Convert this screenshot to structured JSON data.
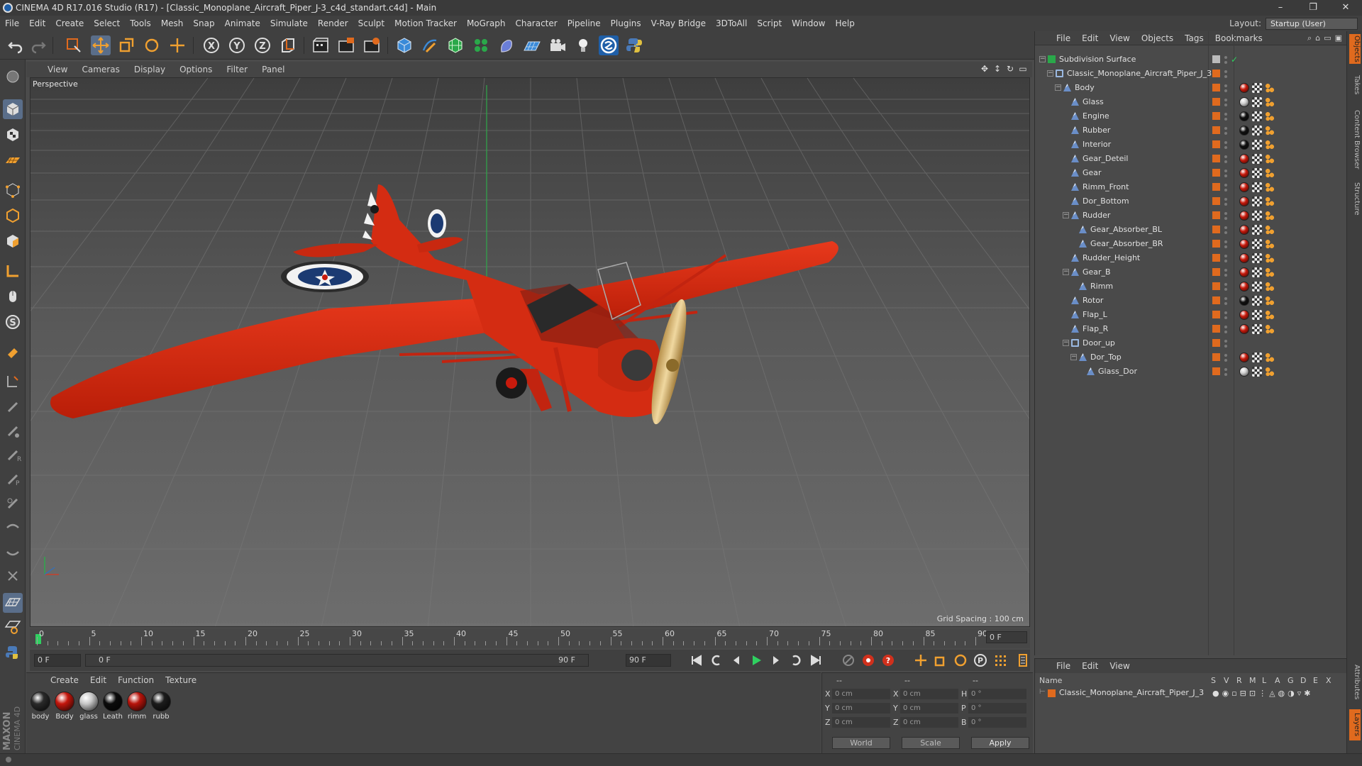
{
  "window": {
    "title": "CINEMA 4D R17.016 Studio (R17) - [Classic_Monoplane_Aircraft_Piper_J-3_c4d_standart.c4d] - Main",
    "controls": [
      "–",
      "❐",
      "✕"
    ]
  },
  "menubar": {
    "items": [
      "File",
      "Edit",
      "Create",
      "Select",
      "Tools",
      "Mesh",
      "Snap",
      "Animate",
      "Simulate",
      "Render",
      "Sculpt",
      "Motion Tracker",
      "MoGraph",
      "Character",
      "Pipeline",
      "Plugins",
      "V-Ray Bridge",
      "3DToAll",
      "Script",
      "Window",
      "Help"
    ],
    "layout_label": "Layout:",
    "layout_value": "Startup (User)"
  },
  "toolbar": {
    "icons": [
      "undo-icon",
      "redo-icon",
      "select-icon",
      "move-icon",
      "scale-icon",
      "rotate-icon",
      "move-plus-icon",
      "x-axis-icon",
      "y-axis-icon",
      "z-axis-icon",
      "coordinate-system-icon",
      "render-view-icon",
      "render-picture-viewer-icon",
      "render-settings-icon",
      "cube-icon",
      "pen-icon",
      "subdivision-icon",
      "cloner-icon",
      "deformer-icon",
      "floor-icon",
      "camera-icon",
      "light-icon",
      "vray-icon",
      "python-icon"
    ]
  },
  "viewport": {
    "menu": [
      "View",
      "Cameras",
      "Display",
      "Options",
      "Filter",
      "Panel"
    ],
    "label": "Perspective",
    "grid_spacing": "Grid Spacing : 100 cm"
  },
  "timeline": {
    "ticks": [
      "0",
      "5",
      "10",
      "15",
      "20",
      "25",
      "30",
      "35",
      "40",
      "45",
      "50",
      "55",
      "60",
      "65",
      "70",
      "75",
      "80",
      "85",
      "90"
    ],
    "current_frame": "0 F"
  },
  "playback": {
    "start": "0 F",
    "range_start": "0 F",
    "range_end": "90 F",
    "end": "90 F"
  },
  "material_manager": {
    "menu": [
      "Create",
      "Edit",
      "Function",
      "Texture"
    ],
    "materials": [
      {
        "label": "body",
        "color": "#2a2a2a"
      },
      {
        "label": "Body",
        "color": "#c4160c"
      },
      {
        "label": "glass",
        "color": "#c9c9c9"
      },
      {
        "label": "Leath",
        "color": "#0b0b0b"
      },
      {
        "label": "rimm",
        "color": "#b8140b"
      },
      {
        "label": "rubb",
        "color": "#1c1c1c"
      }
    ]
  },
  "coordinates": {
    "rows": [
      {
        "a": "X",
        "av": "0 cm",
        "b": "X",
        "bv": "0 cm",
        "c": "H",
        "cv": "0 °"
      },
      {
        "a": "Y",
        "av": "0 cm",
        "b": "Y",
        "bv": "0 cm",
        "c": "P",
        "cv": "0 °"
      },
      {
        "a": "Z",
        "av": "0 cm",
        "b": "Z",
        "bv": "0 cm",
        "c": "B",
        "cv": "0 °"
      }
    ],
    "header_a": "--",
    "header_b": "--",
    "header_c": "--",
    "mode": "World",
    "scale": "Scale",
    "apply": "Apply"
  },
  "object_manager": {
    "menu": [
      "File",
      "Edit",
      "View",
      "Objects",
      "Tags",
      "Bookmarks"
    ],
    "objects": [
      {
        "name": "Subdivision Surface",
        "depth": 0,
        "tree": "−",
        "type": "subdiv",
        "tags": "check"
      },
      {
        "name": "Classic_Monoplane_Aircraft_Piper_J_3",
        "depth": 1,
        "tree": "−",
        "type": "null",
        "tags": ""
      },
      {
        "name": "Body",
        "depth": 2,
        "tree": "−",
        "type": "poly",
        "tags": "red"
      },
      {
        "name": "Glass",
        "depth": 3,
        "tree": "",
        "type": "poly",
        "tags": "glass"
      },
      {
        "name": "Engine",
        "depth": 3,
        "tree": "",
        "type": "poly",
        "tags": "black"
      },
      {
        "name": "Rubber",
        "depth": 3,
        "tree": "",
        "type": "poly",
        "tags": "black"
      },
      {
        "name": "Interior",
        "depth": 3,
        "tree": "",
        "type": "poly",
        "tags": "black"
      },
      {
        "name": "Gear_Deteil",
        "depth": 3,
        "tree": "",
        "type": "poly",
        "tags": "red"
      },
      {
        "name": "Gear",
        "depth": 3,
        "tree": "",
        "type": "poly",
        "tags": "red"
      },
      {
        "name": "Rimm_Front",
        "depth": 3,
        "tree": "",
        "type": "poly",
        "tags": "red"
      },
      {
        "name": "Dor_Bottom",
        "depth": 3,
        "tree": "",
        "type": "poly",
        "tags": "red"
      },
      {
        "name": "Rudder",
        "depth": 3,
        "tree": "−",
        "type": "poly",
        "tags": "red"
      },
      {
        "name": "Gear_Absorber_BL",
        "depth": 4,
        "tree": "",
        "type": "poly",
        "tags": "red"
      },
      {
        "name": "Gear_Absorber_BR",
        "depth": 4,
        "tree": "",
        "type": "poly",
        "tags": "red"
      },
      {
        "name": "Rudder_Height",
        "depth": 3,
        "tree": "",
        "type": "poly",
        "tags": "red"
      },
      {
        "name": "Gear_B",
        "depth": 3,
        "tree": "−",
        "type": "poly",
        "tags": "red"
      },
      {
        "name": "Rimm",
        "depth": 4,
        "tree": "",
        "type": "poly",
        "tags": "red"
      },
      {
        "name": "Rotor",
        "depth": 3,
        "tree": "",
        "type": "poly",
        "tags": "black"
      },
      {
        "name": "Flap_L",
        "depth": 3,
        "tree": "",
        "type": "poly",
        "tags": "red"
      },
      {
        "name": "Flap_R",
        "depth": 3,
        "tree": "",
        "type": "poly",
        "tags": "red"
      },
      {
        "name": "Door_up",
        "depth": 3,
        "tree": "−",
        "type": "null",
        "tags": ""
      },
      {
        "name": "Dor_Top",
        "depth": 4,
        "tree": "−",
        "type": "poly",
        "tags": "red"
      },
      {
        "name": "Glass_Dor",
        "depth": 5,
        "tree": "",
        "type": "poly",
        "tags": "glass"
      }
    ]
  },
  "layer_manager": {
    "menu": [
      "File",
      "Edit",
      "View"
    ],
    "columns": [
      "Name",
      "S",
      "V",
      "R",
      "M",
      "L",
      "A",
      "G",
      "D",
      "E",
      "X"
    ],
    "layer": "Classic_Monoplane_Aircraft_Piper_J_3"
  },
  "side_tabs": [
    "Objects",
    "Takes",
    "Content Browser",
    "Structure",
    "Attributes",
    "Layers"
  ],
  "brand": "MAXON CINEMA 4D",
  "colors": {
    "accent_orange": "#e06a1e",
    "plane_red": "#d8260e",
    "highlight_blue": "#3a6fb0"
  }
}
